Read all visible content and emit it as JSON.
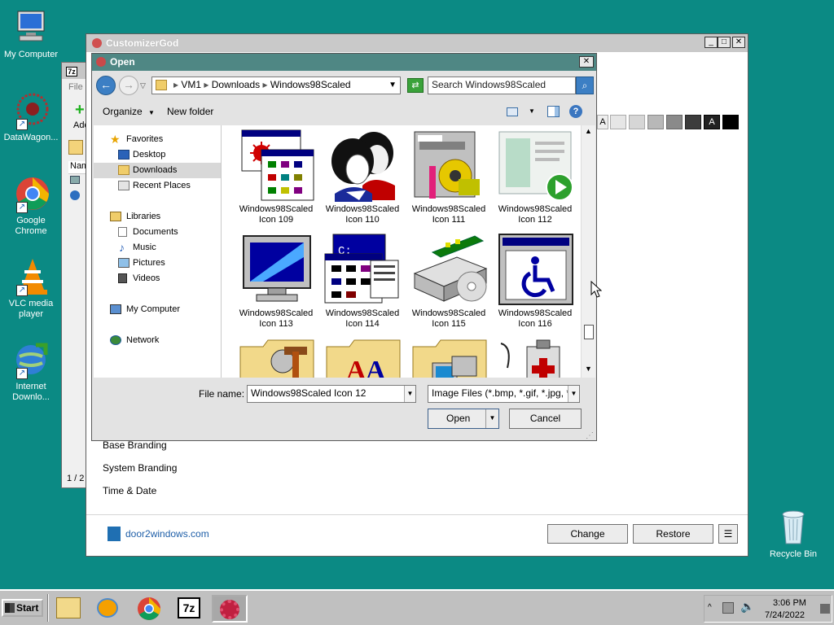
{
  "desktop": {
    "icons": [
      {
        "label": "My Computer"
      },
      {
        "label": "DataWagon..."
      },
      {
        "label": "Google Chrome"
      },
      {
        "label": "VLC media player"
      },
      {
        "label": "Internet Downlo..."
      },
      {
        "label": "Recycle Bin"
      }
    ]
  },
  "sevenzip": {
    "menu_file": "File",
    "toolbar_add": "Add",
    "col_name": "Nam",
    "page_counter": "1 / 2"
  },
  "customizer": {
    "title": "CustomizerGod",
    "sections": [
      "Base Branding",
      "System Branding",
      "Time & Date"
    ],
    "link": "door2windows.com",
    "change_label": "Change",
    "restore_label": "Restore",
    "menu_label": "☰",
    "swatch_letter": "A"
  },
  "open_dialog": {
    "title": "Open",
    "breadcrumb": [
      "VM1",
      "Downloads",
      "Windows98Scaled"
    ],
    "search_placeholder": "Search Windows98Scaled",
    "organize_label": "Organize",
    "new_folder_label": "New folder",
    "nav": {
      "favorites": "Favorites",
      "desktop": "Desktop",
      "downloads": "Downloads",
      "recent": "Recent Places",
      "libraries": "Libraries",
      "documents": "Documents",
      "music": "Music",
      "pictures": "Pictures",
      "videos": "Videos",
      "computer": "My Computer",
      "network": "Network"
    },
    "files": [
      {
        "line1": "Windows98Scaled",
        "line2": "Icon 109"
      },
      {
        "line1": "Windows98Scaled",
        "line2": "Icon 110"
      },
      {
        "line1": "Windows98Scaled",
        "line2": "Icon 111"
      },
      {
        "line1": "Windows98Scaled",
        "line2": "Icon 112"
      },
      {
        "line1": "Windows98Scaled",
        "line2": "Icon 113"
      },
      {
        "line1": "Windows98Scaled",
        "line2": "Icon 114"
      },
      {
        "line1": "Windows98Scaled",
        "line2": "Icon 115"
      },
      {
        "line1": "Windows98Scaled",
        "line2": "Icon 116"
      }
    ],
    "file_name_label": "File name:",
    "file_name_value": "Windows98Scaled Icon 12",
    "file_type_value": "Image Files (*.bmp, *.gif, *.jpg, *",
    "open_label": "Open",
    "cancel_label": "Cancel"
  },
  "taskbar": {
    "start_label": "Start",
    "time": "3:06 PM",
    "date": "7/24/2022"
  }
}
